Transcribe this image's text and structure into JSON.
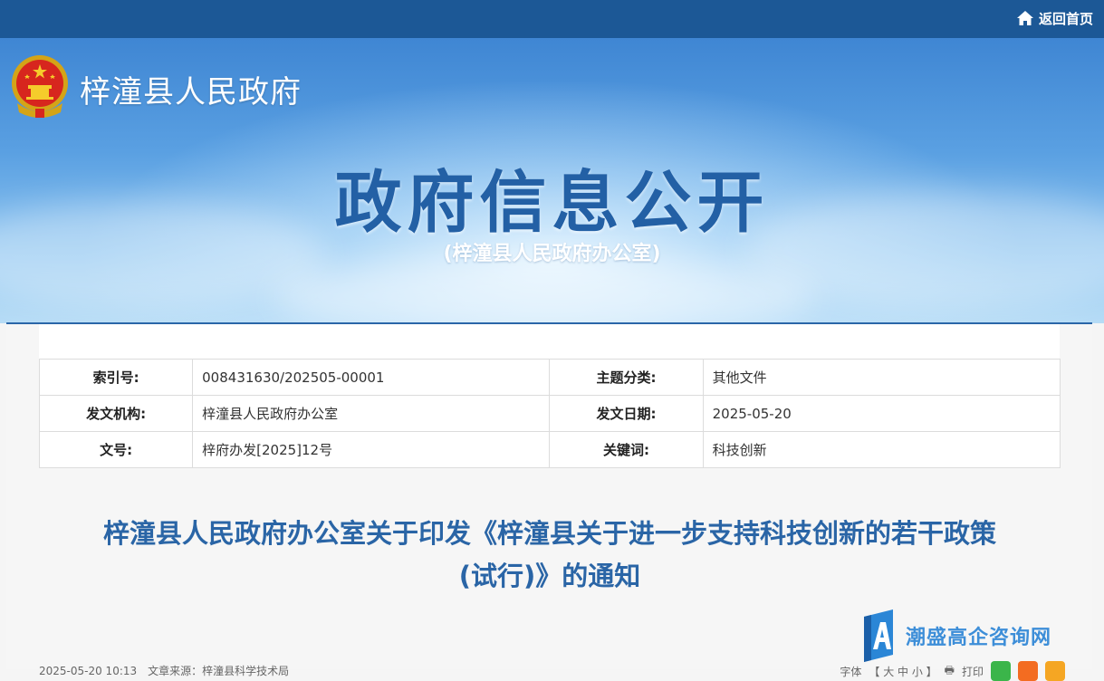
{
  "topbar": {
    "home_label": "返回首页"
  },
  "header": {
    "site_name": "梓潼县人民政府",
    "title": "政府信息公开",
    "subtitle": "(梓潼县人民政府办公室)"
  },
  "meta": {
    "rows": [
      {
        "k1": "索引号:",
        "v1": "008431630/202505-00001",
        "k2": "主题分类:",
        "v2": "其他文件"
      },
      {
        "k1": "发文机构:",
        "v1": "梓潼县人民政府办公室",
        "k2": "发文日期:",
        "v2": "2025-05-20"
      },
      {
        "k1": "文号:",
        "v1": "梓府办发[2025]12号",
        "k2": "关键词:",
        "v2": "科技创新"
      }
    ]
  },
  "document": {
    "title_line1": "梓潼县人民政府办公室关于印发《梓潼县关于进一步支持科技创新的若干政策",
    "title_line2": "(试行)》的通知"
  },
  "footer": {
    "info": "2025-05-20 10:13　文章来源：梓潼县科学技术局",
    "font_label": "字体",
    "font_sizes": "【 大 中 小 】",
    "print_label": "打印"
  },
  "watermark": {
    "text": "潮盛高企咨询网"
  },
  "colors": {
    "topbar": "#1c5896",
    "title_blue": "#2360a5",
    "doc_title": "#2a65a6"
  }
}
